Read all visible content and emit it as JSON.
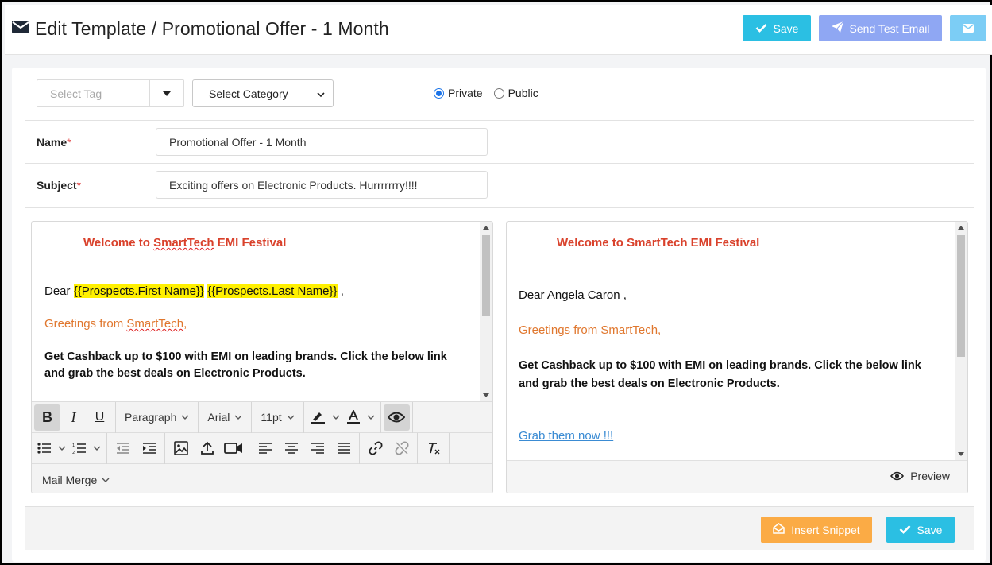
{
  "header": {
    "title": "Edit Template / Promotional Offer - 1 Month",
    "save_label": "Save",
    "send_test_label": "Send Test Email"
  },
  "form": {
    "tag_placeholder": "Select Tag",
    "category_value": "Select Category",
    "visibility_options": [
      "Private",
      "Public"
    ],
    "visibility_selected": "Private",
    "name_label": "Name",
    "name_value": "Promotional Offer - 1 Month",
    "subject_label": "Subject",
    "subject_value": "Exciting offers on Electronic Products. Hurrrrrrry!!!!",
    "required_mark": "*"
  },
  "editor": {
    "welcome_prefix": "Welcome to ",
    "welcome_brand": "SmartTech",
    "welcome_suffix": " EMI Festival",
    "dear": "Dear ",
    "merge_first": "{{Prospects.First Name}}",
    "merge_last": "{{Prospects.Last Name}}",
    "dear_suffix": " ,",
    "greetings_prefix": "Greetings from ",
    "greetings_brand": "SmartTech",
    "greetings_suffix": ",",
    "cashback": "Get Cashback up to $100 with EMI on leading brands. Click the below link and grab the best deals on Electronic Products.",
    "toolbar": {
      "bold": "B",
      "italic": "I",
      "underline": "U",
      "block_format": "Paragraph",
      "font_family": "Arial",
      "font_size": "11pt",
      "mail_merge": "Mail Merge"
    }
  },
  "preview": {
    "welcome": "Welcome to SmartTech EMI Festival",
    "dear": "Dear Angela Caron ,",
    "greetings": "Greetings from SmartTech,",
    "cashback": "Get Cashback up to $100 with EMI on leading brands. Click the below link and grab the best deals on Electronic Products.",
    "link": "Grab them now !!!",
    "preview_label": "Preview"
  },
  "footer": {
    "insert_snippet_label": "Insert Snippet",
    "save_label": "Save"
  },
  "colors": {
    "save": "#2bbfe3",
    "send_test": "#8fa7f3",
    "mail_button": "#7ccdf5",
    "insert_snippet": "#fbab45",
    "welcome_text": "#d9412b",
    "greetings_text": "#e0772e",
    "merge_highlight": "#fff000",
    "link": "#3a8bd3"
  }
}
